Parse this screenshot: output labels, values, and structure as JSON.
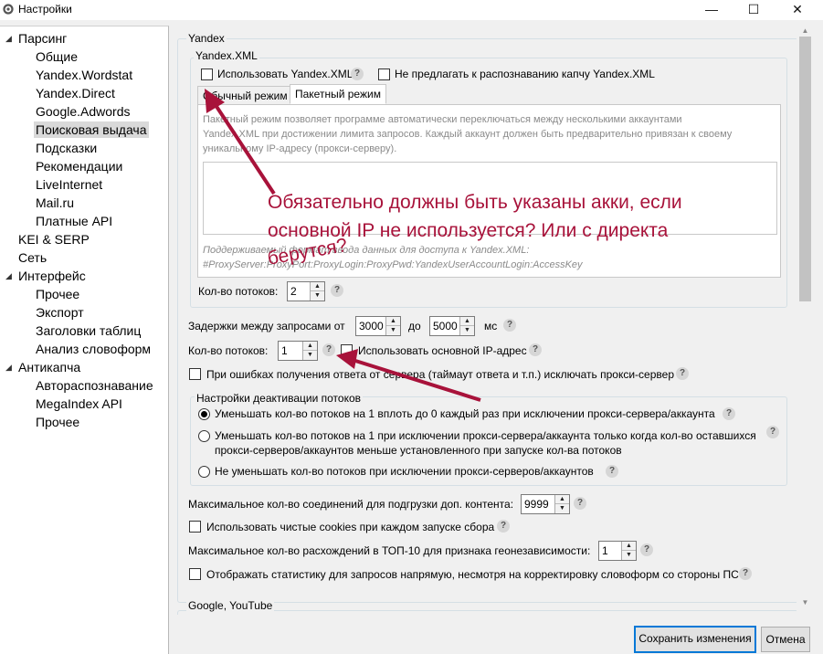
{
  "window": {
    "title": "Настройки",
    "minimize": "—",
    "maximize": "☐",
    "close": "✕"
  },
  "tree": {
    "items": [
      "Парсинг",
      "Общие",
      "Yandex.Wordstat",
      "Yandex.Direct",
      "Google.Adwords",
      "Поисковая выдача",
      "Подсказки",
      "Рекомендации",
      "LiveInternet",
      "Mail.ru",
      "Платные API",
      "KEI & SERP",
      "Сеть",
      "Интерфейс",
      "Прочее",
      "Экспорт",
      "Заголовки таблиц",
      "Анализ словоформ",
      "Антикапча",
      "Автораспознавание",
      "MegaIndex API",
      "Прочее"
    ],
    "expander": "◢"
  },
  "yandex": {
    "group_label": "Yandex",
    "xml": {
      "group_label": "Yandex.XML",
      "use_xml": "Использовать Yandex.XML",
      "no_captcha": "Не предлагать к распознаванию капчу Yandex.XML",
      "tab_normal": "Обычный режим",
      "tab_batch": "Пакетный режим",
      "desc_line1": "Пакетный режим позволяет программе автоматически переключаться между несколькими аккаунтами",
      "desc_line2": "Yandex.XML при достижении лимита запросов. Каждый аккаунт должен быть предварительно привязан к своему",
      "desc_line3": "уникальному IP-адресу (прокси-серверу).",
      "format_line1": "Поддерживаемый формат ввода данных для доступа к Yandex.XML:",
      "format_line2": "#ProxyServer:ProxyPort:ProxyLogin:ProxyPwd:YandexUserAccountLogin:AccessKey",
      "threads_label": "Кол-во потоков:",
      "threads_value": "2"
    },
    "delay_label": "Задержки между запросами от",
    "delay_from": "3000",
    "delay_to_label": "до",
    "delay_to": "5000",
    "delay_unit": "мс",
    "threads_label": "Кол-во потоков:",
    "threads_value": "1",
    "use_main_ip": "Использовать основной IP-адрес",
    "exclude_proxy": "При ошибках получения ответа от сервера (таймаут ответа и т.п.) исключать прокси-сервер",
    "deactivation": {
      "group_label": "Настройки деактивации потоков",
      "opt1": "Уменьшать кол-во потоков на 1 вплоть до 0 каждый раз при исключении прокси-сервера/аккаунта",
      "opt2_line1": "Уменьшать кол-во потоков на 1 при исключении прокси-сервера/аккаунта только когда кол-во оставшихся",
      "opt2_line2": "прокси-серверов/аккаунтов меньше установленного при запуске кол-ва потоков",
      "opt3": "Не уменьшать кол-во потоков при исключении прокси-серверов/аккаунтов"
    },
    "max_conn_label": "Максимальное кол-во соединений для подгрузки доп. контента:",
    "max_conn_value": "9999",
    "clean_cookies": "Использовать чистые cookies при каждом запуске сбора",
    "top10_label": "Максимальное кол-во расхождений в ТОП-10 для признака геонезависимости:",
    "top10_value": "1",
    "show_stats": "Отображать статистику для запросов напрямую, несмотря на корректировку словоформ со стороны ПС"
  },
  "google": {
    "group_label": "Google, YouTube"
  },
  "help_glyph": "?",
  "spin": {
    "up": "▲",
    "down": "▼"
  },
  "scroll": {
    "up": "▲",
    "down": "▼"
  },
  "buttons": {
    "save": "Сохранить изменения",
    "cancel": "Отмена"
  },
  "annotation": {
    "line1": "Обязательно должны быть указаны акки, если",
    "line2": "основной IP не используется? Или с директа",
    "line3": "берутся?",
    "color": "#a8123a"
  }
}
